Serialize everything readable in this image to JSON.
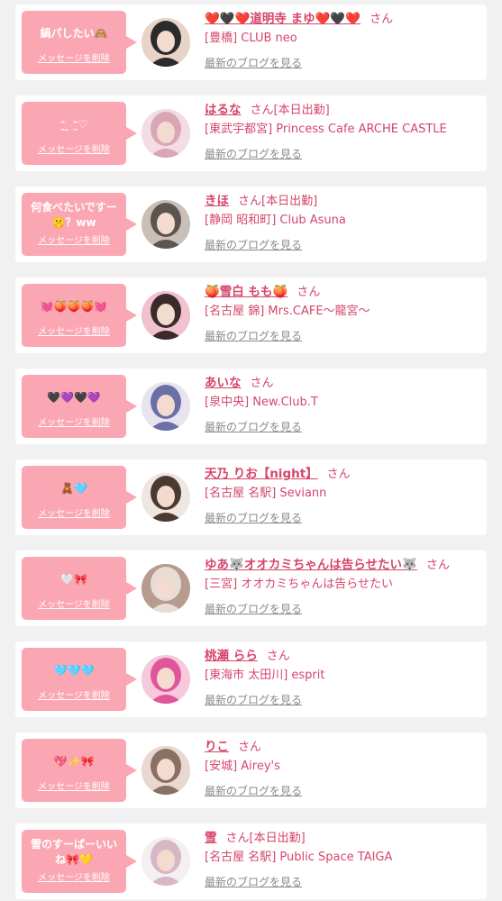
{
  "delete_label": "メッセージを削除",
  "blog_label": "最新のブログを見る",
  "san_label": "さん",
  "favorites": [
    {
      "message": "鍋パしたい🙈",
      "name": "❤️🖤❤️道明寺 まゆ❤️🖤❤️",
      "extra": "",
      "shop": "[豊橋] CLUB neo",
      "avatar_colors": [
        "#2b2b2b",
        "#e8d3c7"
      ]
    },
    {
      "message": "ᵔ̤ ̮ ᵔ̤♡",
      "name": "はるな",
      "extra": "[本日出勤]",
      "shop": "[東武宇都宮] Princess Cafe ARCHE CASTLE",
      "avatar_colors": [
        "#d9a6b6",
        "#f3dce4"
      ]
    },
    {
      "message": "何食べたいですー\n🤫？ww",
      "name": "きほ",
      "extra": "[本日出勤]",
      "shop": "[静岡 昭和町] Club Asuna",
      "avatar_colors": [
        "#5b5450",
        "#c9bfb6"
      ]
    },
    {
      "message": "💓🍑🍑🍑💓",
      "name": "🍑雪白 もも🍑",
      "extra": "",
      "shop": "[名古屋 錦] Mrs.CAFE〜龍宮〜",
      "avatar_colors": [
        "#3a2a2a",
        "#f2c1cf"
      ]
    },
    {
      "message": "🖤💜🖤💜",
      "name": "あいな",
      "extra": "",
      "shop": "[泉中央] New.Club.T",
      "avatar_colors": [
        "#6b6fa8",
        "#e7e4ef"
      ]
    },
    {
      "message": "🧸🩵",
      "name": "天乃 りお【night】",
      "extra": "",
      "shop": "[名古屋 名駅] Seviann",
      "avatar_colors": [
        "#4a3a30",
        "#efe6df"
      ]
    },
    {
      "message": "🤍🎀",
      "name": "ゆあ🐺オオカミちゃんは告らせたい🐺",
      "extra": "",
      "shop": "[三宮] オオカミちゃんは告らせたい",
      "avatar_colors": [
        "#e8dcd6",
        "#b79b8e"
      ]
    },
    {
      "message": "🩵🩵🩵",
      "name": "桃瀬 らら",
      "extra": "",
      "shop": "[東海市 太田川] esprit",
      "avatar_colors": [
        "#e0559b",
        "#f6c9dc"
      ]
    },
    {
      "message": "💖✨🎀",
      "name": "りこ",
      "extra": "",
      "shop": "[安城] Airey's",
      "avatar_colors": [
        "#8a6f63",
        "#e8d8cf"
      ]
    },
    {
      "message": "雪のすーぱーいい\nね🎀💛",
      "name": "雪",
      "extra": "[本日出勤]",
      "shop": "[名古屋 名駅] Public Space TAIGA",
      "avatar_colors": [
        "#d7b7c6",
        "#f4f0f2"
      ]
    }
  ]
}
